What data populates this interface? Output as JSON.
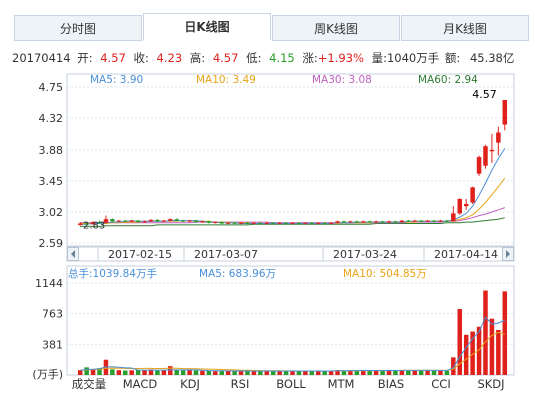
{
  "tabs": [
    {
      "label": "分时图"
    },
    {
      "label": "日K线图"
    },
    {
      "label": "周K线图"
    },
    {
      "label": "月K线图"
    }
  ],
  "active_tab": 1,
  "quote": {
    "date": "20170414",
    "open_label": "开:",
    "open": "4.57",
    "close_label": "收:",
    "close": "4.23",
    "high_label": "高:",
    "high": "4.57",
    "low_label": "低:",
    "low": "4.15",
    "change_label": "涨:",
    "change": "+1.93%",
    "volume_label": "量:",
    "volume": "1040万手",
    "amount_label": "额:",
    "amount": "45.38亿"
  },
  "colors": {
    "up": "#e0201b",
    "down": "#2a9d2a",
    "ma5": "#4a90d9",
    "ma10": "#e8a317",
    "ma30": "#c05fc0",
    "ma60": "#2e7d32"
  },
  "chart_data": [
    {
      "type": "candlestick",
      "ma_legend": [
        {
          "name": "MA5",
          "value": "3.90"
        },
        {
          "name": "MA10",
          "value": "3.49"
        },
        {
          "name": "MA30",
          "value": "3.08"
        },
        {
          "name": "MA60",
          "value": "2.94"
        }
      ],
      "yticks": [
        "4.75",
        "4.32",
        "3.88",
        "3.45",
        "3.02",
        "2.59"
      ],
      "ylim": [
        2.59,
        4.75
      ],
      "xticks": [
        "2017-02-15",
        "2017-03-07",
        "2017-03-24",
        "2017-04-14"
      ],
      "annotations": {
        "max": "4.57",
        "min": "2.83"
      },
      "candles": [
        {
          "o": 2.84,
          "c": 2.86,
          "h": 2.88,
          "l": 2.83
        },
        {
          "o": 2.86,
          "c": 2.85,
          "h": 2.88,
          "l": 2.84
        },
        {
          "o": 2.85,
          "c": 2.88,
          "h": 2.89,
          "l": 2.84
        },
        {
          "o": 2.88,
          "c": 2.87,
          "h": 2.9,
          "l": 2.86
        },
        {
          "o": 2.87,
          "c": 2.92,
          "h": 2.97,
          "l": 2.86
        },
        {
          "o": 2.92,
          "c": 2.89,
          "h": 2.93,
          "l": 2.88
        },
        {
          "o": 2.89,
          "c": 2.9,
          "h": 2.91,
          "l": 2.88
        },
        {
          "o": 2.9,
          "c": 2.89,
          "h": 2.91,
          "l": 2.88
        },
        {
          "o": 2.89,
          "c": 2.9,
          "h": 2.91,
          "l": 2.88
        },
        {
          "o": 2.9,
          "c": 2.88,
          "h": 2.91,
          "l": 2.87
        },
        {
          "o": 2.88,
          "c": 2.89,
          "h": 2.9,
          "l": 2.87
        },
        {
          "o": 2.89,
          "c": 2.91,
          "h": 2.92,
          "l": 2.88
        },
        {
          "o": 2.91,
          "c": 2.89,
          "h": 2.92,
          "l": 2.88
        },
        {
          "o": 2.89,
          "c": 2.9,
          "h": 2.91,
          "l": 2.88
        },
        {
          "o": 2.9,
          "c": 2.92,
          "h": 2.93,
          "l": 2.89
        },
        {
          "o": 2.92,
          "c": 2.9,
          "h": 2.93,
          "l": 2.89
        },
        {
          "o": 2.9,
          "c": 2.89,
          "h": 2.91,
          "l": 2.88
        },
        {
          "o": 2.89,
          "c": 2.9,
          "h": 2.91,
          "l": 2.88
        },
        {
          "o": 2.9,
          "c": 2.88,
          "h": 2.91,
          "l": 2.87
        },
        {
          "o": 2.88,
          "c": 2.89,
          "h": 2.9,
          "l": 2.87
        },
        {
          "o": 2.89,
          "c": 2.87,
          "h": 2.9,
          "l": 2.86
        },
        {
          "o": 2.87,
          "c": 2.88,
          "h": 2.89,
          "l": 2.86
        },
        {
          "o": 2.88,
          "c": 2.86,
          "h": 2.89,
          "l": 2.85
        },
        {
          "o": 2.86,
          "c": 2.87,
          "h": 2.88,
          "l": 2.85
        },
        {
          "o": 2.87,
          "c": 2.86,
          "h": 2.88,
          "l": 2.85
        },
        {
          "o": 2.86,
          "c": 2.87,
          "h": 2.88,
          "l": 2.85
        },
        {
          "o": 2.87,
          "c": 2.86,
          "h": 2.88,
          "l": 2.85
        },
        {
          "o": 2.86,
          "c": 2.87,
          "h": 2.88,
          "l": 2.85
        },
        {
          "o": 2.87,
          "c": 2.86,
          "h": 2.88,
          "l": 2.85
        },
        {
          "o": 2.86,
          "c": 2.87,
          "h": 2.88,
          "l": 2.85
        },
        {
          "o": 2.87,
          "c": 2.86,
          "h": 2.88,
          "l": 2.85
        },
        {
          "o": 2.86,
          "c": 2.87,
          "h": 2.88,
          "l": 2.85
        },
        {
          "o": 2.87,
          "c": 2.86,
          "h": 2.88,
          "l": 2.85
        },
        {
          "o": 2.86,
          "c": 2.87,
          "h": 2.88,
          "l": 2.85
        },
        {
          "o": 2.87,
          "c": 2.86,
          "h": 2.88,
          "l": 2.85
        },
        {
          "o": 2.86,
          "c": 2.87,
          "h": 2.88,
          "l": 2.85
        },
        {
          "o": 2.87,
          "c": 2.86,
          "h": 2.88,
          "l": 2.85
        },
        {
          "o": 2.86,
          "c": 2.87,
          "h": 2.88,
          "l": 2.85
        },
        {
          "o": 2.87,
          "c": 2.86,
          "h": 2.88,
          "l": 2.85
        },
        {
          "o": 2.86,
          "c": 2.87,
          "h": 2.88,
          "l": 2.85
        },
        {
          "o": 2.87,
          "c": 2.89,
          "h": 2.9,
          "l": 2.86
        },
        {
          "o": 2.89,
          "c": 2.88,
          "h": 2.9,
          "l": 2.87
        },
        {
          "o": 2.88,
          "c": 2.89,
          "h": 2.9,
          "l": 2.87
        },
        {
          "o": 2.89,
          "c": 2.88,
          "h": 2.9,
          "l": 2.87
        },
        {
          "o": 2.88,
          "c": 2.89,
          "h": 2.9,
          "l": 2.87
        },
        {
          "o": 2.89,
          "c": 2.88,
          "h": 2.9,
          "l": 2.87
        },
        {
          "o": 2.88,
          "c": 2.89,
          "h": 2.9,
          "l": 2.87
        },
        {
          "o": 2.89,
          "c": 2.88,
          "h": 2.9,
          "l": 2.87
        },
        {
          "o": 2.88,
          "c": 2.89,
          "h": 2.9,
          "l": 2.87
        },
        {
          "o": 2.89,
          "c": 2.88,
          "h": 2.9,
          "l": 2.87
        },
        {
          "o": 2.88,
          "c": 2.9,
          "h": 2.91,
          "l": 2.87
        },
        {
          "o": 2.9,
          "c": 2.89,
          "h": 2.91,
          "l": 2.88
        },
        {
          "o": 2.89,
          "c": 2.9,
          "h": 2.91,
          "l": 2.88
        },
        {
          "o": 2.9,
          "c": 2.89,
          "h": 2.91,
          "l": 2.88
        },
        {
          "o": 2.89,
          "c": 2.9,
          "h": 2.91,
          "l": 2.88
        },
        {
          "o": 2.9,
          "c": 2.89,
          "h": 2.91,
          "l": 2.88
        },
        {
          "o": 2.89,
          "c": 2.9,
          "h": 2.91,
          "l": 2.88
        },
        {
          "o": 2.9,
          "c": 2.89,
          "h": 2.91,
          "l": 2.88
        },
        {
          "o": 2.89,
          "c": 3.0,
          "h": 3.1,
          "l": 2.89
        },
        {
          "o": 3.0,
          "c": 3.2,
          "h": 3.21,
          "l": 2.98
        },
        {
          "o": 3.1,
          "c": 3.13,
          "h": 3.2,
          "l": 3.05
        },
        {
          "o": 3.15,
          "c": 3.36,
          "h": 3.37,
          "l": 3.13
        },
        {
          "o": 3.55,
          "c": 3.78,
          "h": 3.8,
          "l": 3.52
        },
        {
          "o": 3.66,
          "c": 3.93,
          "h": 3.95,
          "l": 3.62
        },
        {
          "o": 3.86,
          "c": 3.88,
          "h": 4.1,
          "l": 3.7
        },
        {
          "o": 3.98,
          "c": 4.12,
          "h": 4.2,
          "l": 3.8
        },
        {
          "o": 4.23,
          "c": 4.57,
          "h": 4.57,
          "l": 4.15
        }
      ],
      "ma5": [
        2.85,
        2.85,
        2.86,
        2.86,
        2.87,
        2.88,
        2.88,
        2.89,
        2.9,
        2.89,
        2.89,
        2.89,
        2.89,
        2.89,
        2.9,
        2.9,
        2.9,
        2.9,
        2.9,
        2.89,
        2.88,
        2.88,
        2.87,
        2.87,
        2.87,
        2.86,
        2.86,
        2.86,
        2.86,
        2.86,
        2.86,
        2.86,
        2.86,
        2.86,
        2.86,
        2.86,
        2.86,
        2.86,
        2.86,
        2.86,
        2.87,
        2.87,
        2.87,
        2.88,
        2.88,
        2.88,
        2.88,
        2.88,
        2.88,
        2.88,
        2.88,
        2.89,
        2.89,
        2.89,
        2.89,
        2.89,
        2.89,
        2.89,
        2.91,
        2.95,
        3.0,
        3.1,
        3.25,
        3.42,
        3.6,
        3.76,
        3.9
      ],
      "ma10": [
        2.86,
        2.86,
        2.86,
        2.86,
        2.86,
        2.87,
        2.87,
        2.88,
        2.88,
        2.88,
        2.89,
        2.89,
        2.89,
        2.89,
        2.89,
        2.89,
        2.9,
        2.9,
        2.89,
        2.89,
        2.89,
        2.88,
        2.88,
        2.88,
        2.87,
        2.87,
        2.87,
        2.86,
        2.86,
        2.86,
        2.86,
        2.86,
        2.86,
        2.86,
        2.86,
        2.86,
        2.86,
        2.86,
        2.86,
        2.86,
        2.86,
        2.87,
        2.87,
        2.87,
        2.87,
        2.87,
        2.88,
        2.88,
        2.88,
        2.88,
        2.88,
        2.88,
        2.88,
        2.89,
        2.89,
        2.89,
        2.89,
        2.89,
        2.9,
        2.92,
        2.94,
        2.98,
        3.06,
        3.15,
        3.26,
        3.37,
        3.49
      ],
      "ma30": [
        2.87,
        2.87,
        2.87,
        2.87,
        2.87,
        2.87,
        2.87,
        2.87,
        2.87,
        2.87,
        2.87,
        2.87,
        2.87,
        2.87,
        2.87,
        2.87,
        2.87,
        2.87,
        2.88,
        2.88,
        2.88,
        2.88,
        2.88,
        2.88,
        2.88,
        2.88,
        2.88,
        2.88,
        2.88,
        2.88,
        2.87,
        2.87,
        2.87,
        2.87,
        2.87,
        2.87,
        2.87,
        2.87,
        2.87,
        2.87,
        2.87,
        2.87,
        2.87,
        2.87,
        2.87,
        2.87,
        2.87,
        2.87,
        2.87,
        2.87,
        2.87,
        2.88,
        2.88,
        2.88,
        2.88,
        2.88,
        2.88,
        2.89,
        2.89,
        2.9,
        2.92,
        2.94,
        2.97,
        2.99,
        3.02,
        3.05,
        3.08
      ],
      "ma60": [
        2.82,
        2.82,
        2.82,
        2.82,
        2.83,
        2.83,
        2.83,
        2.83,
        2.83,
        2.83,
        2.83,
        2.83,
        2.84,
        2.84,
        2.84,
        2.84,
        2.84,
        2.84,
        2.84,
        2.84,
        2.84,
        2.84,
        2.84,
        2.84,
        2.84,
        2.84,
        2.84,
        2.85,
        2.85,
        2.85,
        2.85,
        2.85,
        2.85,
        2.85,
        2.85,
        2.85,
        2.85,
        2.85,
        2.85,
        2.85,
        2.85,
        2.85,
        2.85,
        2.85,
        2.85,
        2.85,
        2.86,
        2.86,
        2.86,
        2.86,
        2.86,
        2.86,
        2.86,
        2.86,
        2.86,
        2.86,
        2.86,
        2.87,
        2.87,
        2.87,
        2.88,
        2.88,
        2.89,
        2.9,
        2.91,
        2.92,
        2.94
      ]
    },
    {
      "type": "bar",
      "legend": [
        {
          "label": "总手:",
          "value": "1039.84万手"
        },
        {
          "label": "MA5:",
          "value": "683.96万"
        },
        {
          "label": "MA10:",
          "value": "504.85万"
        }
      ],
      "yticks": [
        "1144",
        "763",
        "381"
      ],
      "ylim": [
        0,
        1144
      ],
      "unit": "(万手)",
      "volumes": [
        60,
        95,
        75,
        85,
        190,
        70,
        60,
        55,
        58,
        62,
        60,
        70,
        55,
        60,
        110,
        65,
        58,
        60,
        55,
        52,
        50,
        48,
        55,
        50,
        48,
        52,
        50,
        48,
        50,
        52,
        48,
        50,
        48,
        52,
        50,
        48,
        50,
        52,
        48,
        50,
        62,
        55,
        58,
        52,
        60,
        55,
        58,
        52,
        60,
        55,
        58,
        60,
        55,
        58,
        60,
        55,
        58,
        52,
        220,
        820,
        500,
        540,
        600,
        1050,
        700,
        560,
        1040
      ],
      "ma5": [
        60,
        68,
        72,
        78,
        101,
        103,
        96,
        90,
        87,
        61,
        61,
        61,
        61,
        61,
        63,
        64,
        64,
        66,
        63,
        58,
        55,
        53,
        52,
        51,
        50,
        51,
        50,
        49,
        50,
        50,
        50,
        49,
        50,
        50,
        50,
        50,
        50,
        50,
        50,
        50,
        52,
        53,
        55,
        55,
        57,
        56,
        56,
        55,
        57,
        56,
        57,
        57,
        57,
        57,
        58,
        57,
        57,
        56,
        89,
        226,
        342,
        451,
        541,
        720,
        633,
        645,
        684
      ],
      "ma10": [
        60,
        64,
        67,
        70,
        82,
        86,
        84,
        82,
        80,
        81,
        82,
        82,
        81,
        81,
        86,
        85,
        80,
        79,
        77,
        74,
        73,
        71,
        69,
        66,
        63,
        60,
        58,
        56,
        55,
        54,
        53,
        52,
        51,
        51,
        50,
        50,
        50,
        50,
        50,
        50,
        51,
        52,
        53,
        53,
        54,
        54,
        55,
        55,
        56,
        56,
        57,
        57,
        57,
        57,
        57,
        57,
        57,
        57,
        73,
        141,
        198,
        256,
        313,
        413,
        493,
        531,
        505
      ]
    }
  ],
  "indicators": [
    "成交量",
    "MACD",
    "KDJ",
    "RSI",
    "BOLL",
    "MTM",
    "BIAS",
    "CCI",
    "SKDJ"
  ]
}
